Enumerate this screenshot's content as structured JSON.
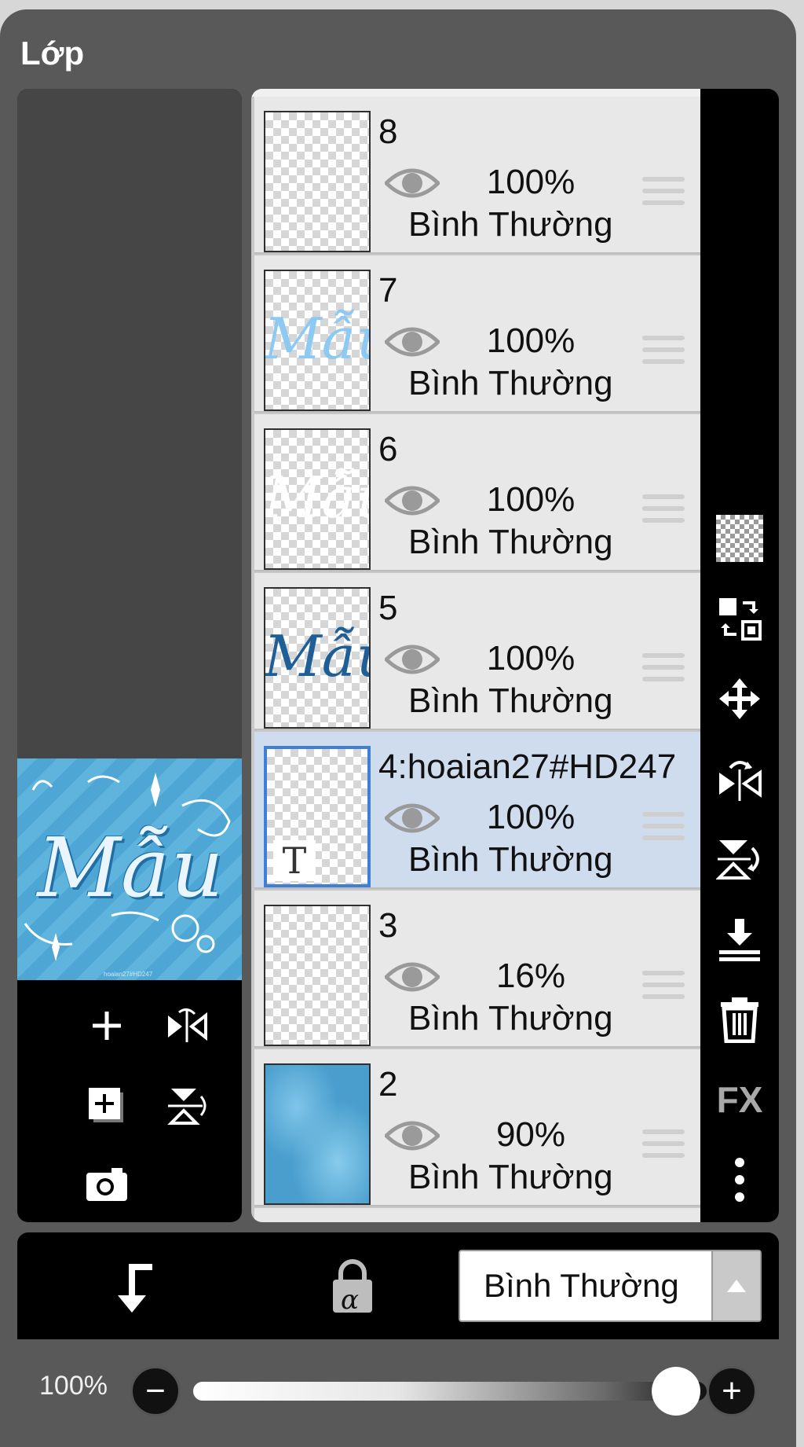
{
  "panel": {
    "title": "Lớp"
  },
  "preview": {
    "text": "Mẫu",
    "credit": "hoaian27#HD247"
  },
  "layers": [
    {
      "name": "8",
      "opacity": "100%",
      "blend": "Bình Thường"
    },
    {
      "name": "7",
      "opacity": "100%",
      "blend": "Bình Thường",
      "thumb_text": "Mẫu"
    },
    {
      "name": "6",
      "opacity": "100%",
      "blend": "Bình Thường",
      "thumb_text": "Mẫu"
    },
    {
      "name": "5",
      "opacity": "100%",
      "blend": "Bình Thường",
      "thumb_text": "Mẫu"
    },
    {
      "name": "4:hoaian27#HD247",
      "opacity": "100%",
      "blend": "Bình Thường",
      "badge": "T",
      "selected": true
    },
    {
      "name": "3",
      "opacity": "16%",
      "blend": "Bình Thường"
    },
    {
      "name": "2",
      "opacity": "90%",
      "blend": "Bình Thường"
    }
  ],
  "right_toolbar": {
    "icons": [
      "transparency-grid-icon",
      "swap-layers-icon",
      "move-icon",
      "flip-horizontal-icon",
      "flip-vertical-icon",
      "merge-down-icon",
      "trash-icon",
      "fx-icon",
      "more-icon"
    ],
    "fx_label": "FX"
  },
  "left_toolbar": {
    "icons": [
      "add-icon",
      "flip-horizontal-icon",
      "add-layer-icon",
      "flip-vertical-icon",
      "camera-icon"
    ]
  },
  "bottom": {
    "blend_mode": "Bình Thường",
    "clip_icon": "clip-arrow-icon",
    "alpha_lock_icon": "alpha-lock-icon",
    "alpha_symbol": "α"
  },
  "opacity_control": {
    "label": "100%",
    "value": 1.0,
    "minus": "−",
    "plus": "+"
  },
  "colors": {
    "panel_bg": "#595959",
    "selected_layer": "#cfdcee",
    "selected_border": "#3f7fd8",
    "layer_bg": "#e8e8e8"
  }
}
